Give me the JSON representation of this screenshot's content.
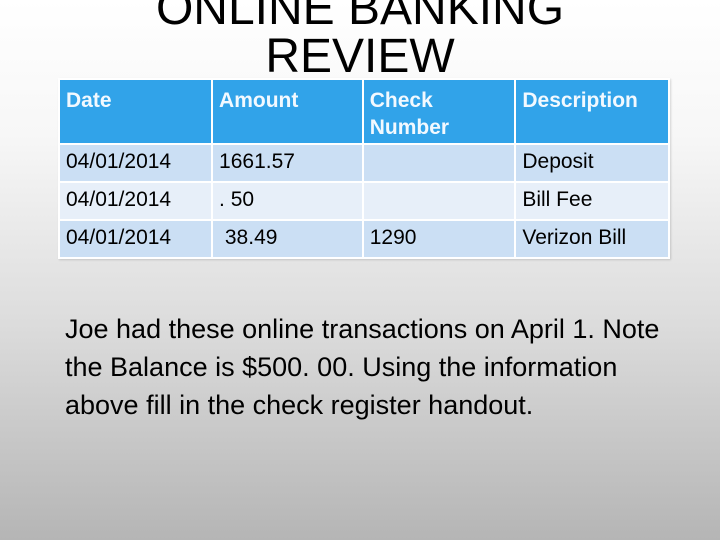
{
  "slide": {
    "title_line1": "ONLINE BANKING",
    "title_line2": "REVIEW",
    "colors": {
      "header_bg": "#31a3e9",
      "row_odd_bg": "#cbdff4",
      "row_even_bg": "#e7eff9",
      "header_text": "#f2f9ff"
    }
  },
  "table": {
    "columns": [
      "Date",
      "Amount",
      "Check Number",
      "Description"
    ],
    "rows": [
      {
        "date": "04/01/2014",
        "amount": "1661.57",
        "check_number": "",
        "description": "Deposit"
      },
      {
        "date": "04/01/2014",
        "amount": ". 50",
        "check_number": "",
        "description": "Bill Fee"
      },
      {
        "date": "04/01/2014",
        "amount": " 38.49",
        "check_number": "1290",
        "description": "Verizon Bill"
      }
    ]
  },
  "instructions": "Joe had these online transactions on April 1. Note the Balance is $500. 00. Using the information above fill in the check register handout."
}
